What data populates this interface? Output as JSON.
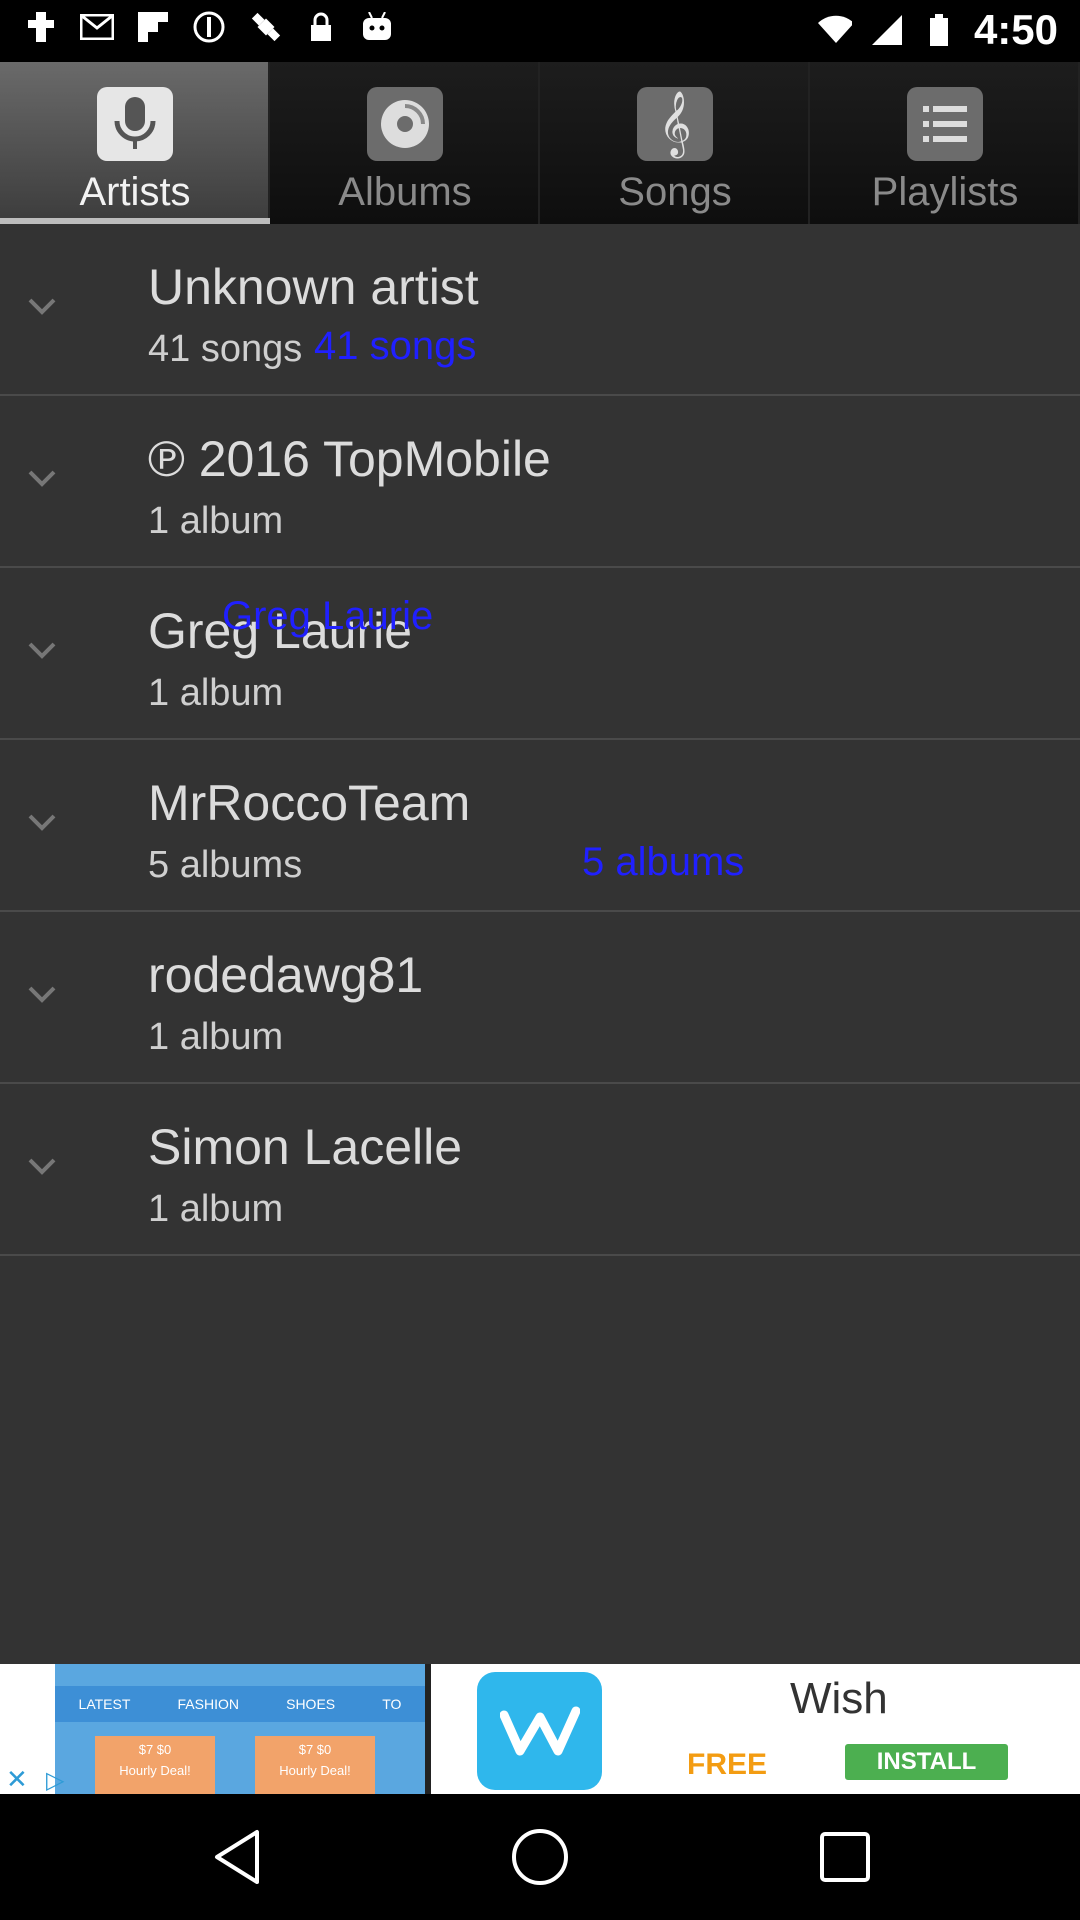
{
  "status_bar": {
    "time": "4:50",
    "icons": [
      "tile-icon",
      "gmail-icon",
      "flipboard-icon",
      "no-entry-icon",
      "fake-gps-icon",
      "lock-icon",
      "android-icon",
      "wifi-icon",
      "signal-icon",
      "battery-icon"
    ]
  },
  "tabs": [
    {
      "label": "Artists",
      "icon": "microphone-icon",
      "active": true
    },
    {
      "label": "Albums",
      "icon": "disc-icon",
      "active": false
    },
    {
      "label": "Songs",
      "icon": "treble-clef-icon",
      "active": false
    },
    {
      "label": "Playlists",
      "icon": "list-icon",
      "active": false
    }
  ],
  "artists": [
    {
      "name": "Unknown artist",
      "count": "41 songs"
    },
    {
      "name": "℗ 2016 TopMobile",
      "count": "1 album"
    },
    {
      "name": "Greg Laurie",
      "count": "1 album"
    },
    {
      "name": "MrRoccoTeam",
      "count": "5 albums"
    },
    {
      "name": "rodedawg81",
      "count": "1 album"
    },
    {
      "name": "Simon Lacelle",
      "count": "1 album"
    }
  ],
  "overlays": {
    "unknown_count": "41 songs",
    "greg_name": "Greg Laurie",
    "rocco_count": "5 albums"
  },
  "ad": {
    "brand": "Wish",
    "free": "FREE",
    "install": "INSTALL",
    "phone_tabs": [
      "LATEST",
      "FASHION",
      "SHOES",
      "TO"
    ],
    "deal_price": "$7 $0",
    "deal_label": "Hourly Deal!"
  },
  "colors": {
    "list_background": "#333333",
    "overlay_text": "#2020ff",
    "wish_blue": "#2fb7ec",
    "install_green": "#4caf50"
  }
}
